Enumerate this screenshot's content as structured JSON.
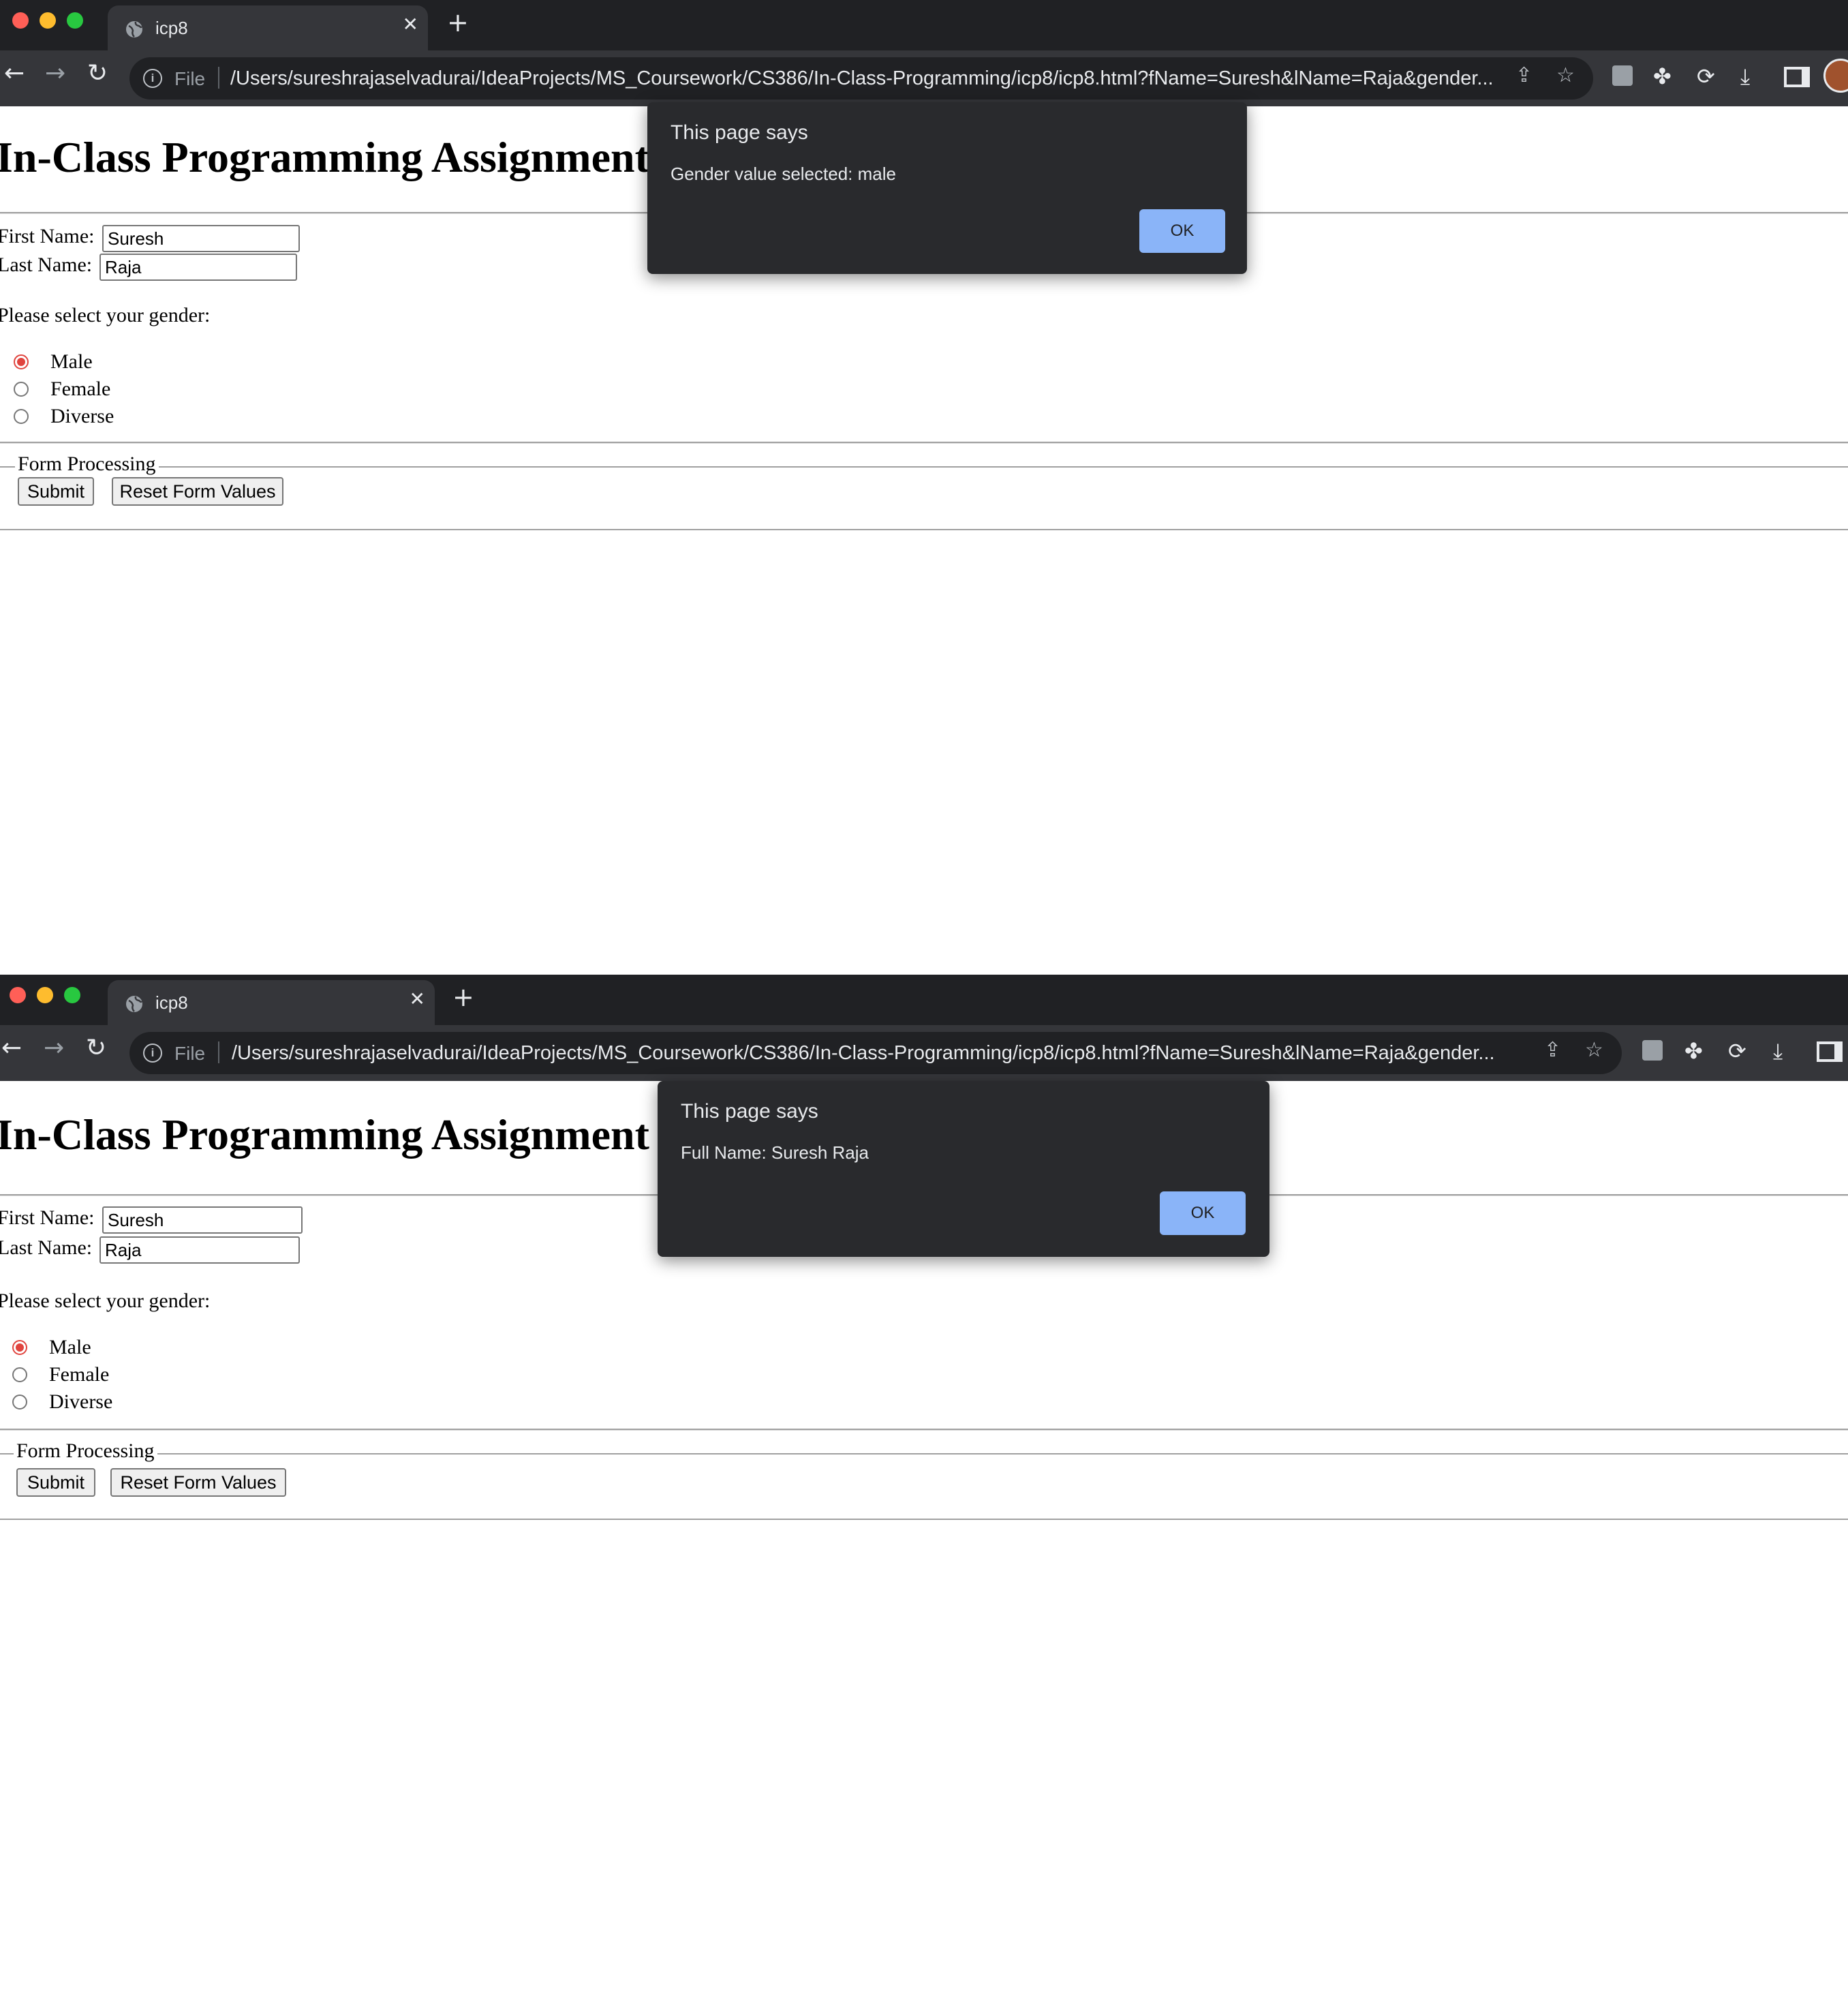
{
  "screenshots": [
    {
      "tab": {
        "title": "icp8",
        "close": "✕",
        "new_tab": "+"
      },
      "toolbar": {
        "back": "←",
        "forward": "→",
        "reload": "↻",
        "scheme": "File",
        "url": "/Users/sureshrajaselvadurai/IdeaProjects/MS_Coursework/CS386/In-Class-Programming/icp8/icp8.html?fName=Suresh&lName=Raja&gender...",
        "share_icon": "share-icon",
        "bookmark_icon": "star-icon",
        "extension_icons": [
          "extension-square-icon",
          "puzzle-icon",
          "sync-icon",
          "download-icon",
          "side-panel-icon",
          "profile-avatar"
        ]
      },
      "page": {
        "heading": "In-Class Programming Assignment",
        "first_name_label": "First Name:",
        "first_name_value": "Suresh",
        "last_name_label": "Last Name:",
        "last_name_value": "Raja",
        "gender_prompt": "Please select your gender:",
        "gender_options": [
          {
            "label": "Male",
            "checked": true
          },
          {
            "label": "Female",
            "checked": false
          },
          {
            "label": "Diverse",
            "checked": false
          }
        ],
        "fieldset_legend": "Form Processing",
        "submit_label": "Submit",
        "reset_label": "Reset Form Values"
      },
      "dialog": {
        "title": "This page says",
        "message": "Gender value selected: male",
        "ok_label": "OK"
      }
    },
    {
      "tab": {
        "title": "icp8",
        "close": "✕",
        "new_tab": "+"
      },
      "toolbar": {
        "back": "←",
        "forward": "→",
        "reload": "↻",
        "scheme": "File",
        "url": "/Users/sureshrajaselvadurai/IdeaProjects/MS_Coursework/CS386/In-Class-Programming/icp8/icp8.html?fName=Suresh&lName=Raja&gender...",
        "share_icon": "share-icon",
        "bookmark_icon": "star-icon",
        "extension_icons": [
          "extension-square-icon",
          "puzzle-icon",
          "sync-icon",
          "download-icon",
          "side-panel-icon"
        ]
      },
      "page": {
        "heading": "In-Class Programming Assignment",
        "first_name_label": "First Name:",
        "first_name_value": "Suresh",
        "last_name_label": "Last Name:",
        "last_name_value": "Raja",
        "gender_prompt": "Please select your gender:",
        "gender_options": [
          {
            "label": "Male",
            "checked": true
          },
          {
            "label": "Female",
            "checked": false
          },
          {
            "label": "Diverse",
            "checked": false
          }
        ],
        "fieldset_legend": "Form Processing",
        "submit_label": "Submit",
        "reset_label": "Reset Form Values"
      },
      "dialog": {
        "title": "This page says",
        "message": "Full Name: Suresh Raja",
        "ok_label": "OK"
      }
    }
  ],
  "colors": {
    "tabbar_bg": "#202124",
    "toolbar_bg": "#35363a",
    "dialog_bg": "#292a2d",
    "ok_button": "#8ab4f8",
    "radio_checked": "#e0443e"
  }
}
